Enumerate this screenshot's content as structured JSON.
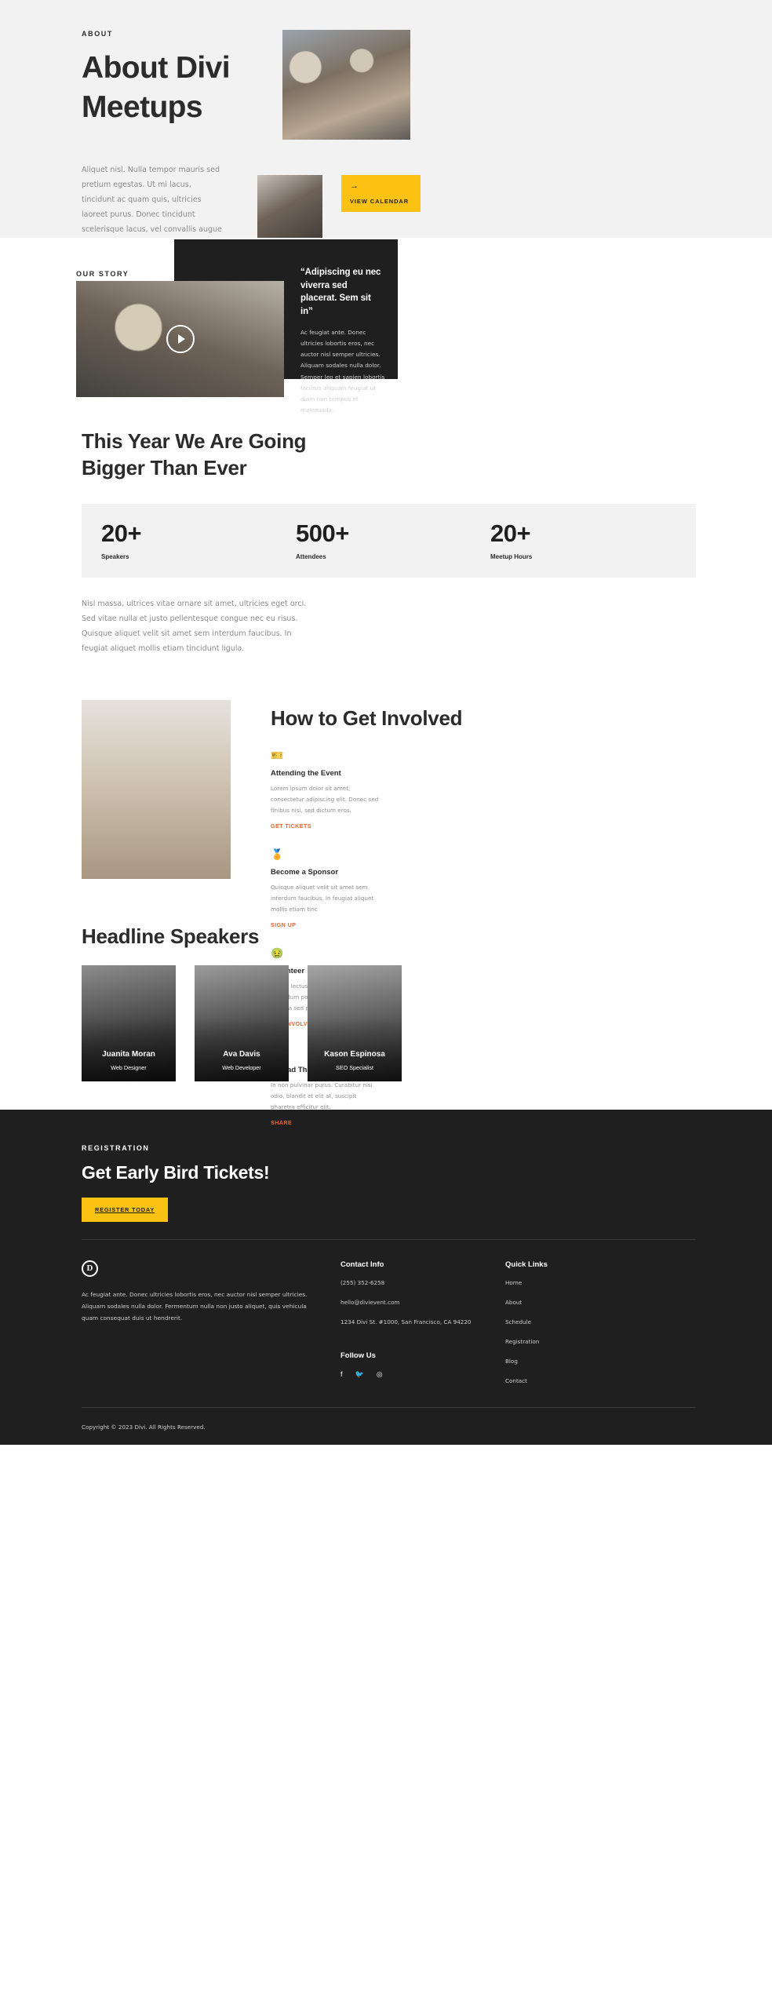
{
  "hero": {
    "eyebrow": "ABOUT",
    "title": "About Divi Meetups",
    "paragraph": "Aliquet nisl. Nulla tempor mauris sed pretium egestas. Ut mi lacus, tincidunt ac quam quis, ultricies laoreet purus. Donec tincidunt scelerisque lacus, vel convallis augue interdum ac. Etiam eget tortor ac odio aliquam lobortis quis at augue. Duis ut hendrerit tellus, elementum lacinia elit. Maecenas at consectetur ex, vitae consequat augue. Vivamus eget dolor vel quam condimentum sodales.",
    "button_label": "VIEW CALENDAR",
    "button_icon": "arrow-right-icon",
    "button_color": "#FBC113",
    "background": "#F2F2F2",
    "photo_main": "meeting-room-photo",
    "photo_small": "woman-at-desk-photo"
  },
  "story": {
    "eyebrow": "OUR STORY",
    "video_photo": "team-around-table-photo",
    "play_icon": "play-circle-icon",
    "quote_title": "“Adipiscing eu nec viverra sed placerat. Sem sit in”",
    "quote_body": "Ac feugiat ante. Donec ultricies lobortis eros, nec auctor nisl semper ultricies. Aliquam sodales nulla dolor. Semper leo et sapien lobortis facilisis aliquam feugiat ut diam non tempus et malesuada.",
    "panel_color": "#1F1F1F"
  },
  "stats": {
    "heading": "This Year We Are Going Bigger Than Ever",
    "box_background": "#F2F2F2",
    "items": [
      {
        "number": "20+",
        "label": "Speakers"
      },
      {
        "number": "500+",
        "label": "Attendees"
      },
      {
        "number": "20+",
        "label": "Meetup Hours"
      }
    ],
    "paragraph": "Nisl massa, ultrices vitae ornare sit amet, ultricies eget orci. Sed vitae nulla et justo pellentesque congue nec eu risus. Quisque aliquet velit sit amet sem interdum faucibus. In feugiat aliquet mollis etiam tincidunt ligula."
  },
  "involved": {
    "photo": "woman-writing-photo",
    "title": "How to Get Involved",
    "icon_color": "#F5B917",
    "link_color": "#E8632C",
    "cards": [
      {
        "icon": "ticket-icon",
        "glyph": "🎫",
        "title": "Attending the Event",
        "body": "Lorem ipsum dolor sit amet, consectetur adipiscing elit. Donec sed finibus nisi, sed dictum eros.",
        "link": "GET TICKETS"
      },
      {
        "icon": "award-medal-icon",
        "glyph": "🏅",
        "title": "Become a Sponsor",
        "body": "Quisque aliquet velit sit amet sem interdum faucibus. In feugiat aliquet mollis etiam tinc",
        "link": "SIGN UP"
      },
      {
        "icon": "hand-heart-icon",
        "glyph": "🤲",
        "title": "Volunteer",
        "body": "Luctus lectus non quisque turpis bibendum posuere. Morbi tortor nibh, fringilla sed pretiu",
        "link": "GET INVOLVED"
      },
      {
        "icon": "megaphone-icon",
        "glyph": "📣",
        "title": "Spread The Word",
        "body": "In non pulvinar purus. Curabitur nisi odio, blandit et elit at, suscipit pharetra efficitur elit.",
        "link": "SHARE"
      }
    ]
  },
  "speakers": {
    "title": "Headline Speakers",
    "people": [
      {
        "name": "Juanita Moran",
        "role": "Web Designer",
        "photo": "speaker-portrait-1"
      },
      {
        "name": "Ava Davis",
        "role": "Web Developer",
        "photo": "speaker-portrait-2"
      },
      {
        "name": "Kason Espinosa",
        "role": "SEO Specialist",
        "photo": "speaker-portrait-3"
      }
    ]
  },
  "registration": {
    "eyebrow": "REGISTRATION",
    "title": "Get Early Bird Tickets!",
    "button_label": "REGISTER TODAY",
    "button_color": "#FBC113",
    "background": "#1F1F1F"
  },
  "footer": {
    "logo": "divi-logo-icon",
    "logo_letter": "D",
    "about": "Ac feugiat ante. Donec ultricies lobortis eros, nec auctor nisl semper ultricies. Aliquam sodales nulla dolor. Fermentum nulla non justo aliquet, quis vehicula quam consequat duis ut hendrerit.",
    "contact_heading": "Contact Info",
    "contact": [
      "(255) 352-6258",
      "hello@divievent.com",
      "1234 Divi St. #1000, San Francisco, CA 94220"
    ],
    "follow_heading": "Follow Us",
    "socials": [
      {
        "name": "facebook-icon",
        "glyph": "f"
      },
      {
        "name": "twitter-icon",
        "glyph": "🐦"
      },
      {
        "name": "instagram-icon",
        "glyph": "◎"
      }
    ],
    "links_heading": "Quick Links",
    "links": [
      "Home",
      "About",
      "Schedule",
      "Registration",
      "Blog",
      "Contact"
    ],
    "copyright": "Copyright © 2023 Divi. All Rights Reserved."
  }
}
